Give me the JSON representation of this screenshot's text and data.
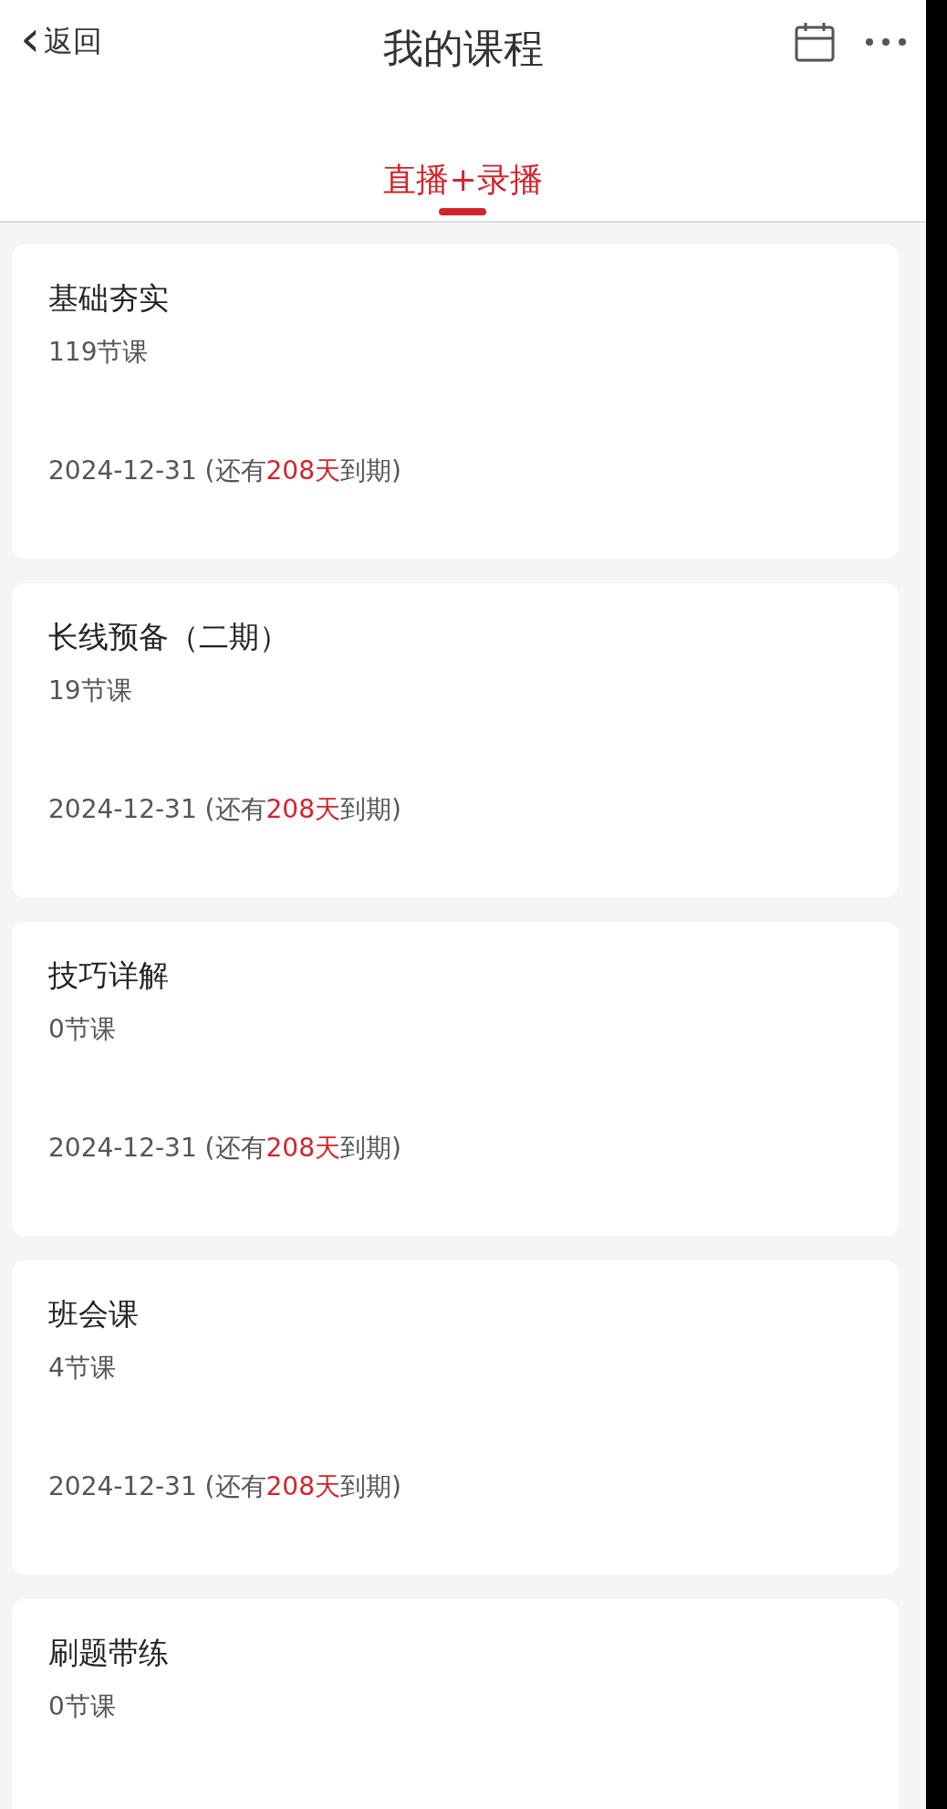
{
  "header": {
    "back": {
      "icon": "‹",
      "label": "返回"
    },
    "title": "我的课程"
  },
  "tabs": [
    {
      "label": "直播+录播",
      "selected": true
    }
  ],
  "courses": [
    {
      "title": "基础夯实",
      "count": "119节课",
      "expiry": [
        "2024-12-31 (还有",
        "208天",
        "到期)"
      ]
    },
    {
      "title": "长线预备（二期）",
      "count": "19节课",
      "expiry": [
        "2024-12-31 (还有",
        "208天",
        "到期)"
      ]
    },
    {
      "title": "技巧详解",
      "count": "0节课",
      "expiry": [
        "2024-12-31 (还有",
        "208天",
        "到期)"
      ]
    },
    {
      "title": "班会课",
      "count": "4节课",
      "expiry": [
        "2024-12-31 (还有",
        "208天",
        "到期)"
      ]
    },
    {
      "title": "刷题带练",
      "count": "0节课"
    }
  ]
}
